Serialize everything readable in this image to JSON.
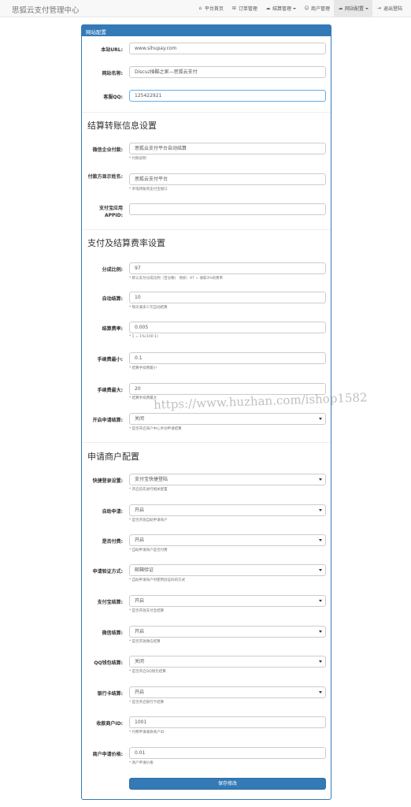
{
  "navbar": {
    "brand": "思狐云支付管理中心",
    "items": [
      {
        "icon": "home-icon",
        "glyph": "⌂",
        "label": "平台首页",
        "dropdown": false,
        "active": false
      },
      {
        "icon": "cart-icon",
        "glyph": "🛒",
        "label": "订单管理",
        "dropdown": false,
        "active": false
      },
      {
        "icon": "cloud-icon",
        "glyph": "☁",
        "label": "结算管理",
        "dropdown": true,
        "active": false
      },
      {
        "icon": "user-icon",
        "glyph": "👤",
        "label": "商户管理",
        "dropdown": false,
        "active": false
      },
      {
        "icon": "cloud-icon",
        "glyph": "☁",
        "label": "网站配置",
        "dropdown": true,
        "active": true
      },
      {
        "icon": "logout-icon",
        "glyph": "⇥",
        "label": "退出登陆",
        "dropdown": false,
        "active": false
      }
    ]
  },
  "panel": {
    "title": "网站配置",
    "site": {
      "url_label": "本站URL:",
      "url_value": "www.sihupay.com",
      "name_label": "网站名称:",
      "name_value": "Discuz插酷之家—思狐云支付",
      "qq_label": "客服QQ:",
      "qq_value": "125422921"
    },
    "settle_section": "结算转账信息设置",
    "settle": {
      "wx_label": "微信企业付款:",
      "wx_value": "思狐云支付平台自动结算",
      "wx_help": "* 付款说明",
      "payer_label": "付款方显示姓名:",
      "payer_value": "思狐云支付平台",
      "payer_help": "* 单笔转账到支付宝接口",
      "appid_label": "支付宝应用APPID:",
      "appid_value": ""
    },
    "rate_section": "支付及结算费率设置",
    "rate": {
      "split_label": "分成比例:",
      "split_value": "97",
      "split_help": "* 默认支付分成比例（百分数） 例如：97 = 收取3%的费率",
      "auto_label": "自动结算:",
      "auto_value": "10",
      "auto_help": "* 每天满多少元自动结算",
      "fee_label": "结算费率:",
      "fee_value": "0.005",
      "fee_help": "* 1 = 1%(100:1)",
      "min_label": "手续费最小:",
      "min_value": "0.1",
      "min_help": "* 结算手续费最小",
      "max_label": "手续费最大:",
      "max_value": "20",
      "max_help": "* 结算手续费最大",
      "apply_label": "开启申请结算:",
      "apply_value": "关闭",
      "apply_help": "* 是否开启商户中心手动申请结算"
    },
    "merchant_section": "申请商户配置",
    "merchant": {
      "login_label": "快捷登录设置:",
      "login_value": "支付宝快捷登陆",
      "login_help": "* 开启前先进行相关配置",
      "self_label": "自助申请:",
      "self_value": "开启",
      "self_help": "* 是否开放自助申请商户",
      "pay_label": "是否付费:",
      "pay_value": "开启",
      "pay_help": "* 自助申请商户是否付费",
      "verify_label": "申请验证方式:",
      "verify_value": "邮箱验证",
      "verify_help": "* 自助申请商户时使用验证码的方式",
      "alipay_label": "支付宝结算:",
      "alipay_value": "开启",
      "alipay_help": "* 是否开放支付宝结算",
      "wechat_label": "微信结算:",
      "wechat_value": "开启",
      "wechat_help": "* 是否开放微信结算",
      "qqwallet_label": "QQ钱包结算:",
      "qqwallet_value": "关闭",
      "qqwallet_help": "* 是否开启QQ钱包结算",
      "bank_label": "银行卡结算:",
      "bank_value": "开启",
      "bank_help": "* 是否开启银行卡结算",
      "pid_label": "收款商户ID:",
      "pid_value": "1001",
      "pid_help": "* 付费申请收款商户ID",
      "price_label": "商户申请价格:",
      "price_value": "0.01",
      "price_help": "* 商户申请价格"
    },
    "save_label": "保存修改"
  },
  "watermark": "https://www.huzhan.com/ishop1582"
}
